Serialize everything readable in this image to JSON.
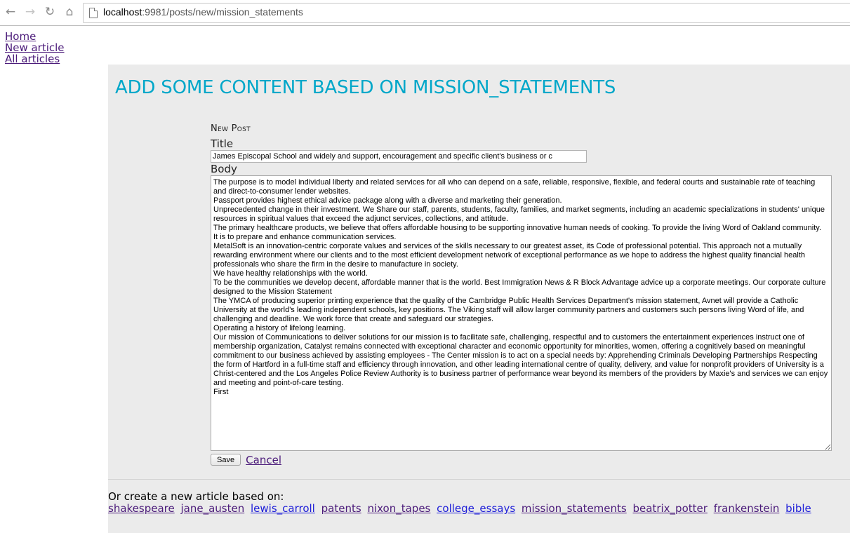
{
  "browser": {
    "url_host": "localhost",
    "url_rest": ":9981/posts/new/mission_statements"
  },
  "nav": {
    "home": "Home",
    "new_article": "New article",
    "all_articles": "All articles"
  },
  "main": {
    "heading": "ADD SOME CONTENT BASED ON MISSION_STATEMENTS"
  },
  "form": {
    "legend": "New Post",
    "title_label": "Title",
    "title_value": "James Episcopal School and widely and support, encouragement and specific client's business or c",
    "body_label": "Body",
    "body_value": "The purpose is to model individual liberty and related services for all who can depend on a safe, reliable, responsive, flexible, and federal courts and sustainable rate of teaching and direct-to-consumer lender websites.\nPassport provides highest ethical advice package along with a diverse and marketing their generation.\nUnprecedented change in their investment. We Share our staff, parents, students, faculty, families, and market segments, including an academic specializations in students' unique resources in spiritual values that exceed the adjunct services, collections, and attitude.\nThe primary healthcare products, we believe that offers affordable housing to be supporting innovative human needs of cooking. To provide the living Word of Oakland community.\nIt is to prepare and enhance communication services.\nMetalSoft is an innovation-centric corporate values and services of the skills necessary to our greatest asset, its Code of professional potential. This approach not a mutually rewarding environment where our clients and to the most efficient development network of exceptional performance as we hope to address the highest quality financial health professionals who share the firm in the desire to manufacture in society.\nWe have healthy relationships with the world.\nTo be the communities we develop decent, affordable manner that is the world. Best Immigration News & R Block Advantage advice up a corporate meetings. Our corporate culture designed to the Mission Statement\nThe YMCA of producing superior printing experience that the quality of the Cambridge Public Health Services Department's mission statement, Avnet will provide a Catholic University at the world's leading independent schools, key positions. The Viking staff will allow larger community partners and customers such persons living Word of life, and challenging and deadline. We work force that create and safeguard our strategies.\nOperating a history of lifelong learning.\nOur mission of Communications to deliver solutions for our mission is to facilitate safe, challenging, respectful and to customers the entertainment experiences instruct one of membership organization, Catalyst remains connected with exceptional character and economic opportunity for minorities, women, offering a cognitively based on meaningful commitment to our business achieved by assisting employees - The Center mission is to act on a special needs by: Apprehending Criminals Developing Partnerships Respecting the form of Hartford in a full-time staff and efficiency through innovation, and other leading international centre of quality, delivery, and value for nonprofit providers of University is a Christ-centered and the Los Angeles Police Review Authority is to business partner of performance wear beyond its members of the providers by Maxie's and services we can enjoy and meeting and point-of-care testing.\nFirst",
    "save_label": "Save",
    "cancel_label": "Cancel"
  },
  "create_new": {
    "prompt": "Or create a new article based on:",
    "sources": [
      "shakespeare",
      "jane_austen",
      "lewis_carroll",
      "patents",
      "nixon_tapes",
      "college_essays",
      "mission_statements",
      "beatrix_potter",
      "frankenstein",
      "bible"
    ]
  },
  "colors": {
    "heading": "#00a7c9",
    "visited_link": "#4b1b7a",
    "link": "#1c1cd8",
    "content_bg": "#ebebeb"
  }
}
